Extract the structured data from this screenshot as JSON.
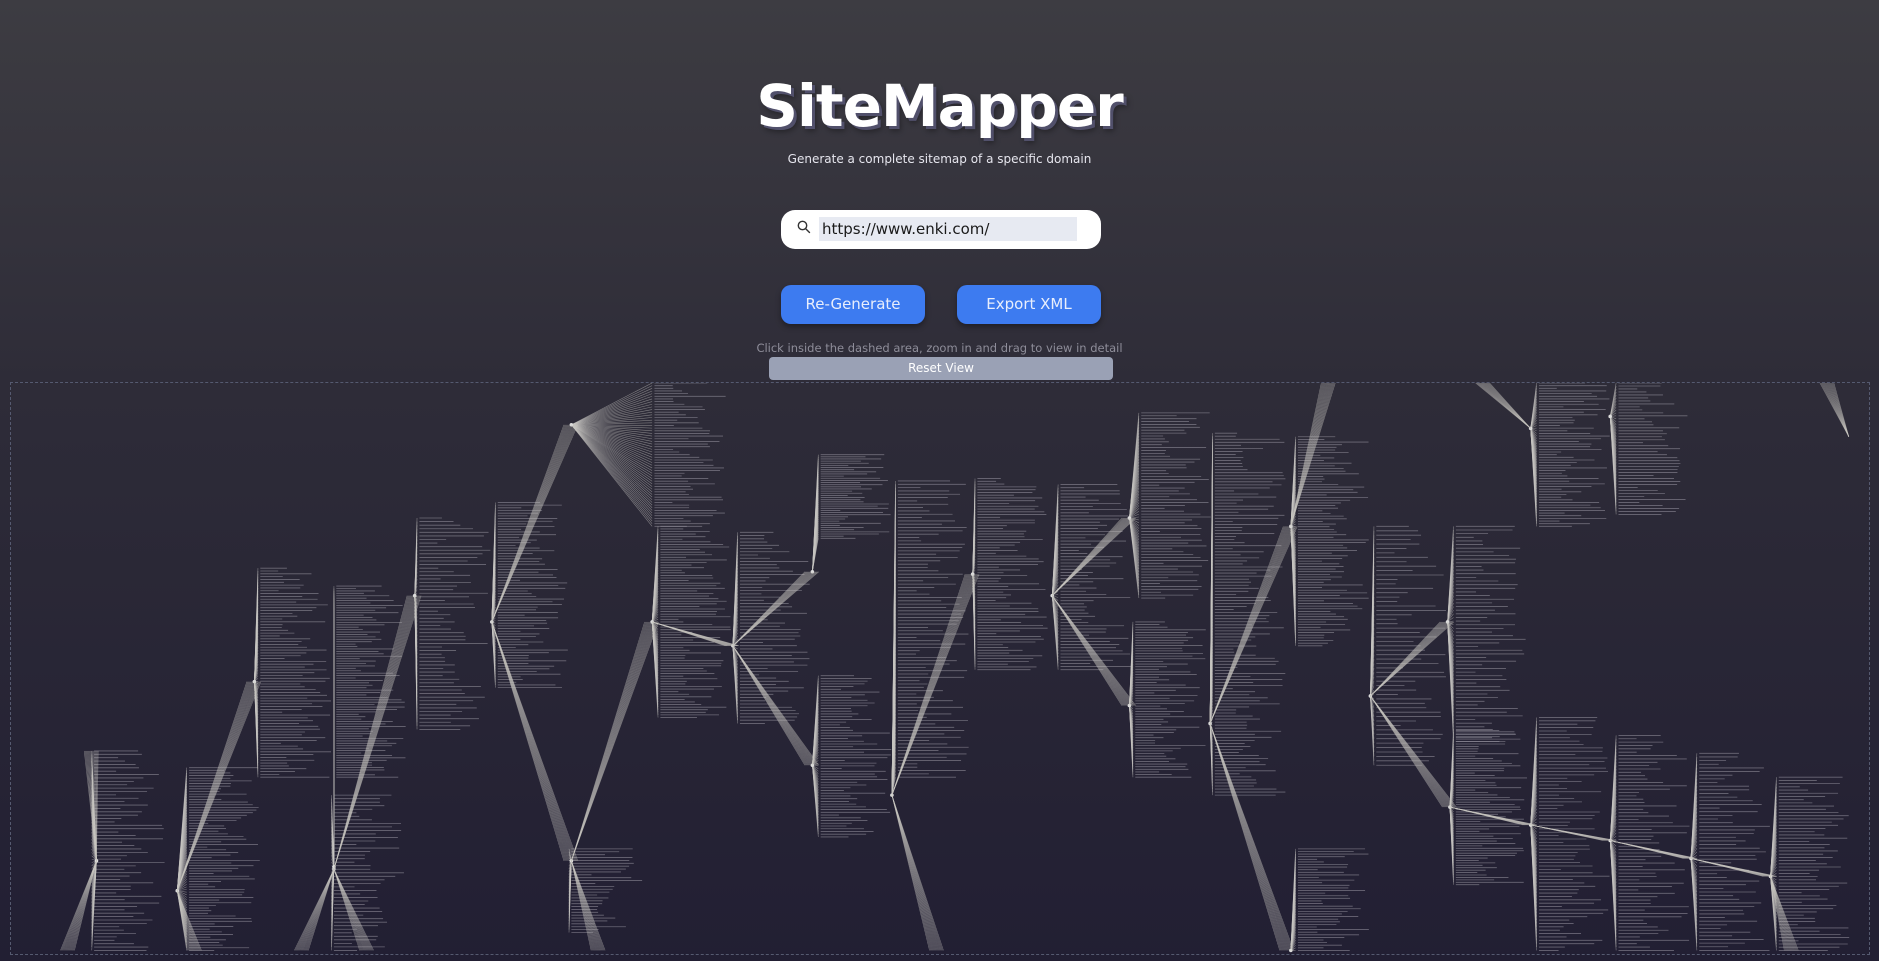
{
  "app": {
    "title": "SiteMapper",
    "subtitle": "Generate a complete sitemap of a specific domain"
  },
  "search": {
    "value": "https://www.enki.com/",
    "icon": "search-icon"
  },
  "buttons": {
    "regenerate_label": "Re-Generate",
    "export_label": "Export XML",
    "reset_label": "Reset View"
  },
  "hint": "Click inside the dashed area, zoom in and drag to view in detail",
  "colors": {
    "accent": "#3d7bf0",
    "reset_button": "#9aa1b5",
    "link_lines": "#c9c7c2"
  }
}
